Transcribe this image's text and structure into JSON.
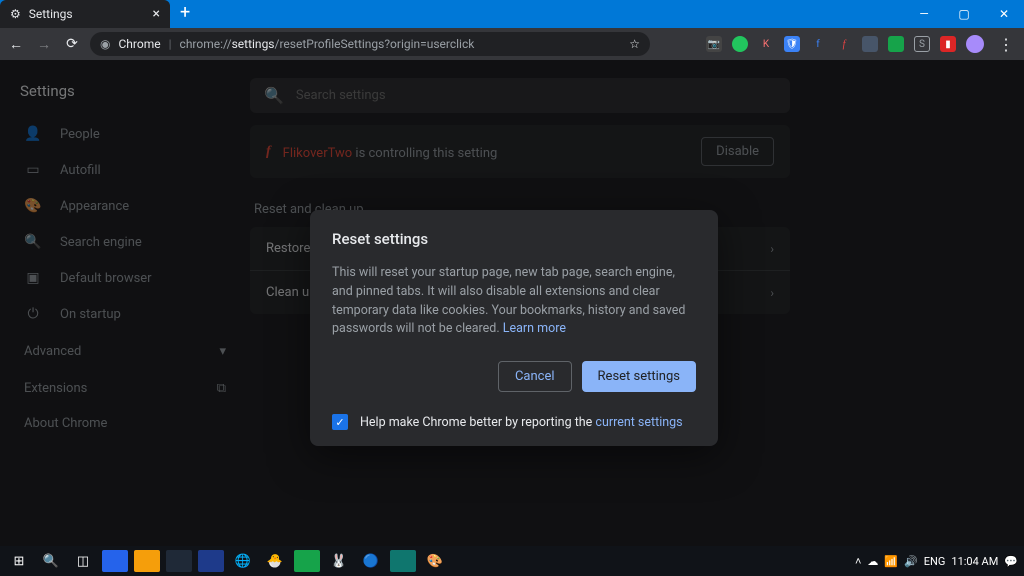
{
  "titlebar": {
    "tab_title": "Settings",
    "new_tab_icon": "+"
  },
  "urlbar": {
    "chrome_label": "Chrome",
    "path_prefix": "chrome://",
    "path_bold": "settings",
    "path_rest": "/resetProfileSettings?origin=userclick"
  },
  "sidebar": {
    "title": "Settings",
    "items": [
      {
        "icon": "person-icon",
        "glyph": "👤",
        "label": "People"
      },
      {
        "icon": "autofill-icon",
        "glyph": "▭",
        "label": "Autofill"
      },
      {
        "icon": "appearance-icon",
        "glyph": "🎨",
        "label": "Appearance"
      },
      {
        "icon": "search-icon",
        "glyph": "🔍",
        "label": "Search engine"
      },
      {
        "icon": "default-browser-icon",
        "glyph": "▣",
        "label": "Default browser"
      },
      {
        "icon": "startup-icon",
        "glyph": "⏻",
        "label": "On startup"
      }
    ],
    "advanced": "Advanced",
    "extensions": "Extensions",
    "about": "About Chrome"
  },
  "main": {
    "search_placeholder": "Search settings",
    "ext_banner": {
      "name": "FlikoverTwo",
      "msg": " is controlling this setting",
      "disable": "Disable"
    },
    "section": "Reset and clean up",
    "rows": [
      "Restore settings to their original defaults",
      "Clean up computer"
    ]
  },
  "dialog": {
    "title": "Reset settings",
    "body": "This will reset your startup page, new tab page, search engine, and pinned tabs. It will also disable all extensions and clear temporary data like cookies. Your bookmarks, history and saved passwords will not be cleared. ",
    "learn_more": "Learn more",
    "cancel": "Cancel",
    "confirm": "Reset settings",
    "help_prefix": "Help make Chrome better by reporting the ",
    "help_link": "current settings"
  },
  "taskbar": {
    "tray": {
      "lang": "ENG",
      "time": "11:04 AM"
    }
  }
}
